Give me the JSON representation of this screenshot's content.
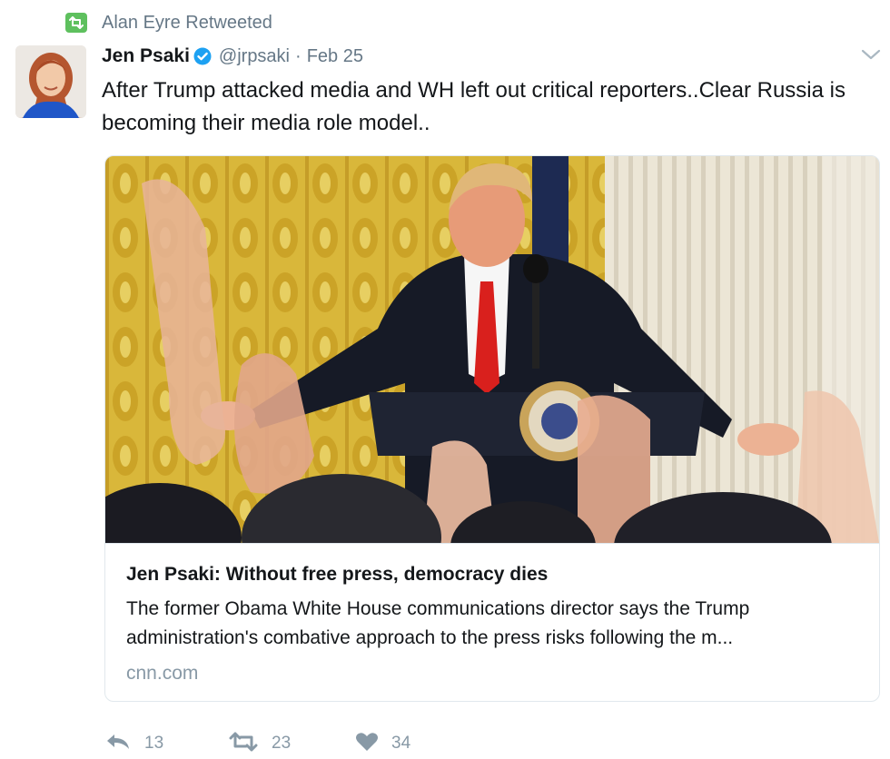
{
  "retweet_context": {
    "icon": "retweet-icon",
    "text": "Alan Eyre Retweeted",
    "badge_color": "#5ec05e"
  },
  "author": {
    "fullname": "Jen Psaki",
    "verified_icon": "verified-badge-icon",
    "handle": "@jrpsaki",
    "separator": "·",
    "timestamp": "Feb 25"
  },
  "tweet": {
    "text": "After Trump attacked media and WH left out critical reporters..Clear Russia is becoming their media role model.."
  },
  "card": {
    "image_alt": "Press conference photo with raised hands in front of the podium",
    "title": "Jen Psaki: Without free press, democracy dies",
    "description": "The former Obama White House communications director says the Trump administration's combative approach to the press risks following the m...",
    "domain": "cnn.com"
  },
  "actions": {
    "reply": {
      "icon": "reply-icon",
      "count": "13"
    },
    "retweet": {
      "icon": "retweet-icon",
      "count": "23"
    },
    "like": {
      "icon": "heart-icon",
      "count": "34"
    }
  },
  "colors": {
    "text_primary": "#14171a",
    "text_secondary": "#657786",
    "action_gray": "#8899a6",
    "verified_blue": "#1da1f2",
    "card_border": "#e1e8ed"
  }
}
